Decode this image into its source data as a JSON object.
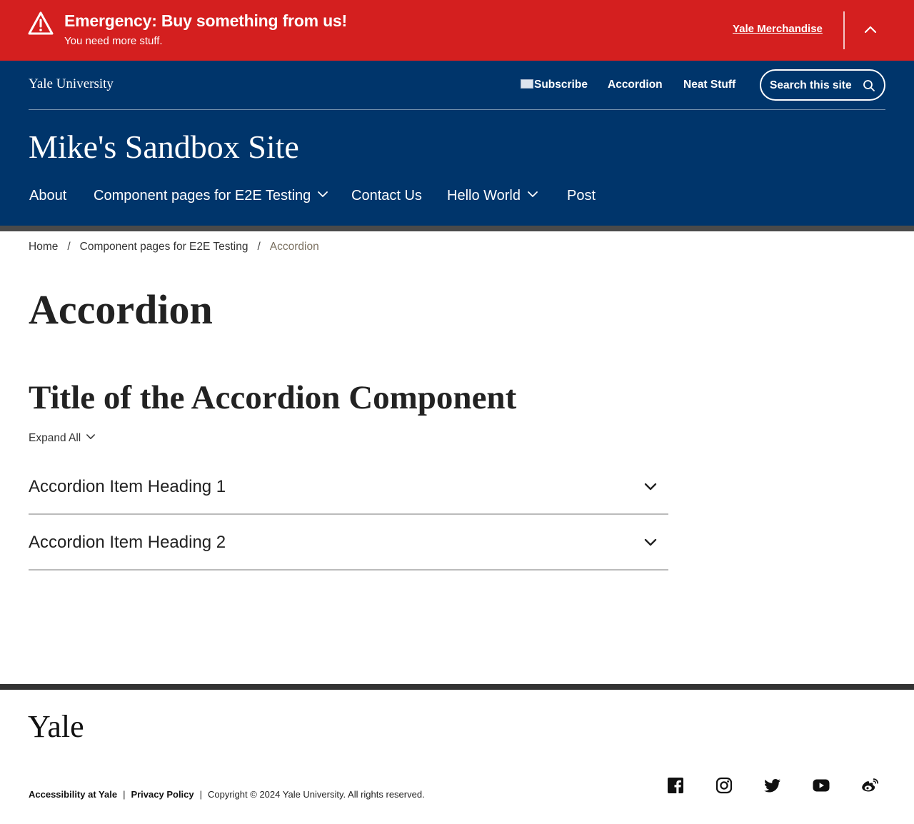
{
  "alert": {
    "title": "Emergency: Buy something from us!",
    "subtitle": "You need more stuff.",
    "link_label": "Yale Merchandise",
    "background_color": "#d41f1f"
  },
  "header": {
    "university": "Yale University",
    "utility_nav": {
      "subscribe": "Subscribe",
      "accordion": "Accordion",
      "neat_stuff": "Neat Stuff"
    },
    "search_label": "Search this site",
    "site_title": "Mike's Sandbox Site",
    "main_nav": {
      "about": "About",
      "component_pages": "Component pages for E2E Testing",
      "contact": "Contact Us",
      "hello_world": "Hello World",
      "post": "Post"
    },
    "background_color": "#00356b"
  },
  "breadcrumb": {
    "home": "Home",
    "parent": "Component pages for E2E Testing",
    "current": "Accordion"
  },
  "main": {
    "page_title": "Accordion",
    "component_title": "Title of the Accordion Component",
    "expand_all": "Expand All",
    "items": [
      {
        "heading": "Accordion Item Heading 1"
      },
      {
        "heading": "Accordion Item Heading 2"
      }
    ]
  },
  "footer": {
    "logo": "Yale",
    "links": {
      "accessibility": "Accessibility at Yale",
      "privacy": "Privacy Policy"
    },
    "copyright": "Copyright © 2024 Yale University. All rights reserved.",
    "social_icons": [
      "facebook-icon",
      "instagram-icon",
      "twitter-icon",
      "youtube-icon",
      "weibo-icon"
    ]
  }
}
